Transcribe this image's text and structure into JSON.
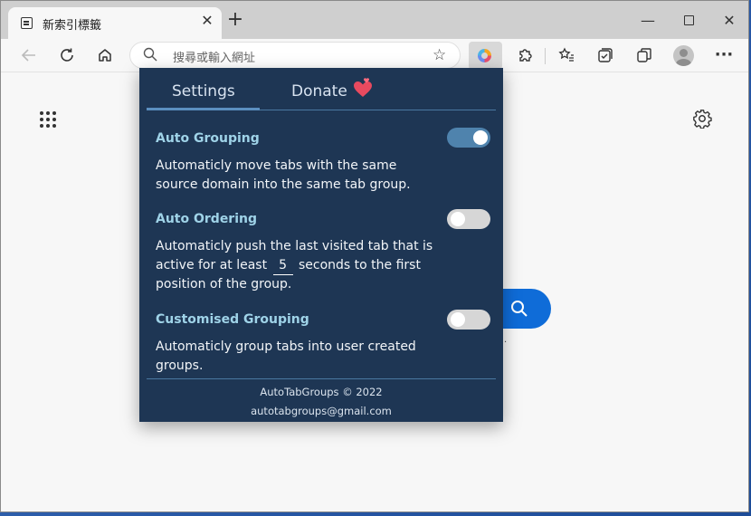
{
  "browser": {
    "tab_title": "新索引標籤",
    "tab_close": "✕",
    "new_tab": "+",
    "address_placeholder": "搜尋或輸入網址",
    "window_controls": {
      "minimize": "—",
      "close": "✕"
    }
  },
  "popup": {
    "tabs": [
      {
        "label": "Settings",
        "active": true
      },
      {
        "label": "Donate",
        "active": false
      }
    ],
    "sections": [
      {
        "title": "Auto Grouping",
        "enabled": true,
        "description": "Automaticly move tabs with the same source domain into the same tab group."
      },
      {
        "title": "Auto Ordering",
        "enabled": false,
        "description_before": "Automaticly push the last visited tab that is active for at least",
        "seconds_value": "5",
        "description_after": "seconds to the first position of the group."
      },
      {
        "title": "Customised Grouping",
        "enabled": false,
        "description": "Automaticly group tabs into user created groups."
      }
    ],
    "footer": {
      "copyright": "AutoTabGroups © 2022",
      "email": "autotabgroups@gmail.com"
    }
  },
  "colors": {
    "popup_bg": "#1e3654",
    "section_title": "#9fd3e8",
    "toggle_on": "#4f83ad",
    "search_button": "#0f6cd8"
  },
  "icons": [
    "new-tab-page-icon",
    "back-icon",
    "reload-icon",
    "home-icon",
    "search-icon",
    "favorite-add-icon",
    "extension-icon",
    "puzzle-icon",
    "favorites-icon",
    "collections-icon",
    "workspaces-icon",
    "profile-icon",
    "more-icon",
    "apps-grid-icon",
    "settings-gear-icon",
    "hearts-icon"
  ]
}
